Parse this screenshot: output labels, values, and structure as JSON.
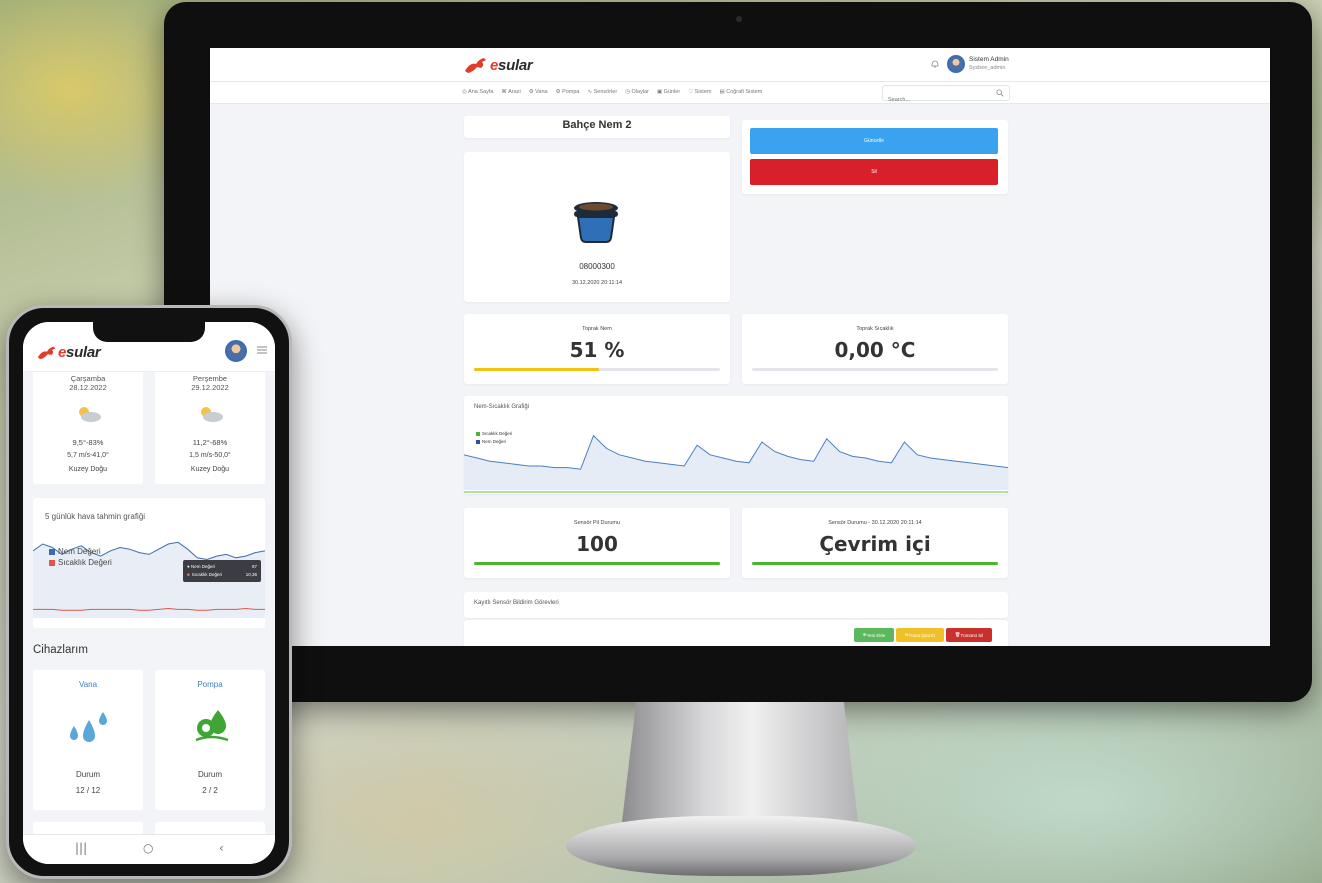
{
  "app": {
    "logo_prefix": "e",
    "logo_name": "sular"
  },
  "header": {
    "user_name": "Sistem Admin",
    "user_role": "Sysbee_admin"
  },
  "nav": {
    "items": [
      {
        "icon": "home-icon",
        "label": "Ana Sayfa"
      },
      {
        "icon": "close-icon",
        "label": "Arazi"
      },
      {
        "icon": "valve-icon",
        "label": "Vana"
      },
      {
        "icon": "pump-icon",
        "label": "Pompa"
      },
      {
        "icon": "sensor-icon",
        "label": "Sensörler"
      },
      {
        "icon": "events-icon",
        "label": "Olaylar"
      },
      {
        "icon": "calendar-icon",
        "label": "Günler"
      },
      {
        "icon": "shield-icon",
        "label": "Sistem"
      },
      {
        "icon": "map-icon",
        "label": "Coğrafi Sistem"
      }
    ],
    "search_placeholder": "Search..."
  },
  "sensor_page": {
    "title": "Bahçe Nem 2",
    "btn_update": "Güncelle",
    "btn_delete": "Sil",
    "device_id": "08000300",
    "device_date": "30.12.2020 20:11:14",
    "soil_moisture_label": "Toprak Nem",
    "soil_moisture_value": "51 %",
    "soil_moisture_percent": 51,
    "soil_temp_label": "Toprak Sıcaklık",
    "soil_temp_value": "0,00 °C",
    "soil_temp_percent": 0,
    "chart_title": "Nem-Sıcaklık Grafiği",
    "legend_temp": "Sıcaklık Değeri",
    "legend_humidity": "Nem Değeri",
    "battery_label": "Sensör Pil Durumu",
    "battery_value": "100",
    "battery_percent": 100,
    "status_label": "Sensör Durumu - 30.12.2020 20:11:14",
    "status_value": "Çevrim içi",
    "status_percent": 100,
    "tasks_title": "Kayıtlı Sensör Bildirim Görevleri",
    "task_new": "Yeni Ekle",
    "task_disable": "Tümü İptal Et",
    "task_delete": "Tümünü Sil"
  },
  "colors": {
    "blue": "#3aa3ef",
    "red": "#d7202a",
    "yellow": "#f4c20d",
    "green": "#4cb42e",
    "task_green": "#5cb85c",
    "task_yellow": "#f0c028",
    "task_red": "#c9302c"
  },
  "phone": {
    "weather": [
      {
        "day": "Çarşamba",
        "date": "28.12.2022",
        "temp": "9,5°-83%",
        "wind": "5,7 m/s-41,0°",
        "dir": "Kuzey Doğu"
      },
      {
        "day": "Perşembe",
        "date": "29.12.2022",
        "temp": "11,2°-68%",
        "wind": "1,5 m/s-50,0°",
        "dir": "Kuzey Doğu"
      }
    ],
    "forecast_title": "5 günlük hava tahmin grafiği",
    "legend_humidity": "Nem Değeri",
    "legend_temp": "Sıcaklık Değeri",
    "tooltip_humidity_label": "Nem Değeri",
    "tooltip_humidity_value": "87",
    "tooltip_temp_label": "Sıcaklık Değeri",
    "tooltip_temp_value": "10,36",
    "devices_title": "Cihazlarım",
    "devices": [
      {
        "name": "Vana",
        "label": "Durum",
        "value": "12 / 12",
        "icon": "water-drops-icon"
      },
      {
        "name": "Pompa",
        "label": "Durum",
        "value": "2 / 2",
        "icon": "pump-gear-icon"
      }
    ]
  },
  "chart_data": [
    {
      "type": "line",
      "title": "Nem-Sıcaklık Grafiği",
      "series": [
        {
          "name": "Nem Değeri",
          "values": [
            62,
            60,
            58,
            57,
            56,
            55,
            55,
            54,
            54,
            53,
            74,
            66,
            62,
            60,
            58,
            57,
            56,
            55,
            68,
            62,
            60,
            58,
            57,
            70,
            64,
            61,
            59,
            58,
            72,
            64,
            61,
            60,
            58,
            57,
            70,
            62,
            60,
            59,
            58,
            57,
            56,
            55,
            54
          ]
        },
        {
          "name": "Sıcaklık Değeri",
          "values": [
            0,
            0,
            0,
            0,
            0,
            0,
            0,
            0,
            0,
            0,
            0,
            0,
            0,
            0,
            0,
            0,
            0,
            0,
            0,
            0,
            0,
            0,
            0,
            0,
            0,
            0,
            0,
            0,
            0,
            0,
            0,
            0,
            0,
            0,
            0,
            0,
            0,
            0,
            0,
            0,
            0,
            0,
            0
          ]
        }
      ],
      "ylim": [
        0,
        100
      ]
    },
    {
      "type": "line",
      "title": "5 günlük hava tahmin grafiği",
      "series": [
        {
          "name": "Nem Değeri",
          "values": [
            78,
            86,
            82,
            74,
            80,
            84,
            76,
            72,
            78,
            82,
            80,
            76,
            74,
            80,
            86,
            88,
            80,
            70,
            68,
            72,
            74,
            70,
            72,
            76,
            78
          ]
        },
        {
          "name": "Sıcaklık Değeri",
          "values": [
            10,
            10,
            10,
            9,
            9,
            9,
            10,
            10,
            10,
            10,
            10,
            9,
            9,
            10,
            11,
            10,
            10,
            9,
            9,
            10,
            10,
            10,
            11,
            10,
            10
          ]
        }
      ],
      "ylim": [
        0,
        100
      ]
    }
  ]
}
